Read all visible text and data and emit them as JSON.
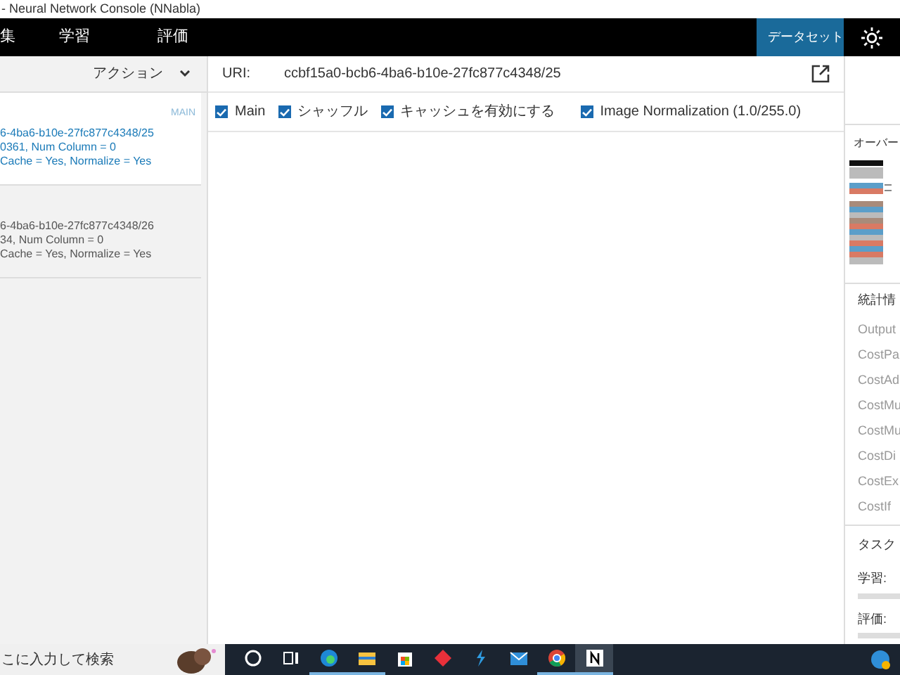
{
  "window": {
    "title": "- Neural Network Console (NNabla)"
  },
  "nav": {
    "tabs": [
      {
        "label": "集",
        "selected": false
      },
      {
        "label": "学習",
        "selected": false
      },
      {
        "label": "評価",
        "selected": false
      }
    ],
    "dataset_button": "データセット"
  },
  "sidebar": {
    "action_label": "アクション",
    "items": [
      {
        "selected": true,
        "badge": "MAIN",
        "lines": [
          "6-4ba6-b10e-27fc877c4348/25",
          "0361, Num Column = 0",
          "Cache = Yes, Normalize = Yes"
        ]
      },
      {
        "selected": false,
        "lines": [
          "6-4ba6-b10e-27fc877c4348/26",
          "34, Num Column = 0",
          "Cache = Yes, Normalize = Yes"
        ]
      }
    ]
  },
  "uri": {
    "label": "URI:",
    "value": "ccbf15a0-bcb6-4ba6-b10e-27fc877c4348/25"
  },
  "options": [
    {
      "label": "Main",
      "checked": true
    },
    {
      "label": "シャッフル",
      "checked": true
    },
    {
      "label": "キャッシュを有効にする",
      "checked": true
    },
    {
      "label": "Image Normalization (1.0/255.0)",
      "checked": true
    }
  ],
  "right_panel": {
    "overview_title": "オーバー",
    "stats_title": "統計情",
    "stats": [
      "Output",
      "CostPa",
      "CostAd",
      "CostMu",
      "CostMu",
      "CostDi",
      "CostEx",
      "CostIf"
    ],
    "task_title": "タスク",
    "tasks": [
      {
        "label": "学習:",
        "level": 0
      },
      {
        "label": "評価:",
        "level": 0
      }
    ]
  },
  "taskbar": {
    "search_placeholder": "こに入力して検索",
    "apps": [
      {
        "kind": "cortana",
        "running": false
      },
      {
        "kind": "taskview",
        "running": false
      },
      {
        "kind": "edge",
        "running": true
      },
      {
        "kind": "folder",
        "running": true
      },
      {
        "kind": "store",
        "running": false
      },
      {
        "kind": "diamond",
        "running": false
      },
      {
        "kind": "bolt",
        "running": false
      },
      {
        "kind": "mail",
        "running": false
      },
      {
        "kind": "chrome",
        "running": true
      },
      {
        "kind": "n-app",
        "running": true
      }
    ]
  }
}
